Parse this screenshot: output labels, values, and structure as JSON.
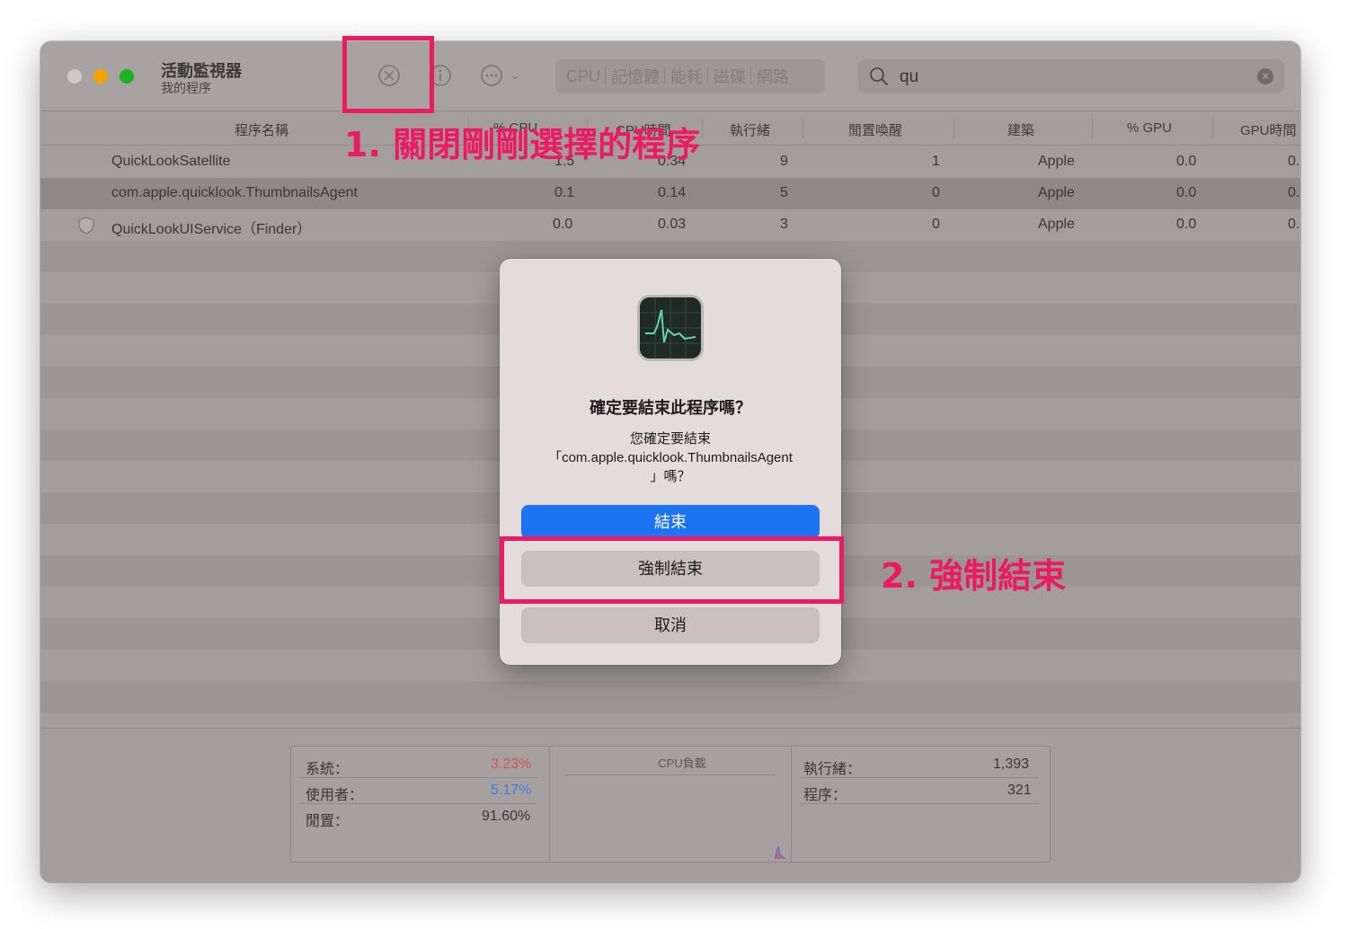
{
  "app": {
    "title": "活動監視器",
    "subtitle": "我的程序"
  },
  "toolbar": {
    "tabs": [
      "CPU",
      "記憶體",
      "能耗",
      "磁碟",
      "網路"
    ],
    "search_value": "qu"
  },
  "table": {
    "columns": [
      "程序名稱",
      "% CPU",
      "CPU時間",
      "執行緒",
      "閒置喚醒",
      "建築",
      "% GPU",
      "GPU時間"
    ],
    "rows": [
      {
        "name": "QuickLookSatellite",
        "cpu": "1.5",
        "cpu_time": "0.34",
        "threads": "9",
        "idle_wake": "1",
        "arch": "Apple",
        "gpu": "0.0",
        "gpu_time": "0."
      },
      {
        "name": "com.apple.quicklook.ThumbnailsAgent",
        "cpu": "0.1",
        "cpu_time": "0.14",
        "threads": "5",
        "idle_wake": "0",
        "arch": "Apple",
        "gpu": "0.0",
        "gpu_time": "0."
      },
      {
        "name": "QuickLookUIService（Finder）",
        "cpu": "0.0",
        "cpu_time": "0.03",
        "threads": "3",
        "idle_wake": "0",
        "arch": "Apple",
        "gpu": "0.0",
        "gpu_time": "0."
      }
    ]
  },
  "footer": {
    "system_label": "系統：",
    "system_value": "3.23%",
    "user_label": "使用者：",
    "user_value": "5.17%",
    "idle_label": "閒置：",
    "idle_value": "91.60%",
    "cpu_load_title": "CPU負載",
    "threads_label": "執行緒：",
    "threads_value": "1,393",
    "processes_label": "程序：",
    "processes_value": "321",
    "colors": {
      "system": "#d9534f",
      "user": "#3d7fe0"
    }
  },
  "dialog": {
    "title": "確定要結束此程序嗎？",
    "message_line1": "您確定要結束",
    "message_line2": "「com.apple.quicklook.ThumbnailsAgent",
    "message_line3": "」嗎？",
    "quit_label": "結束",
    "force_quit_label": "強制結束",
    "cancel_label": "取消"
  },
  "annotations": {
    "step1": "1. 關閉剛剛選擇的程序",
    "step2": "2. 強制結束",
    "color": "#ec1a62"
  }
}
